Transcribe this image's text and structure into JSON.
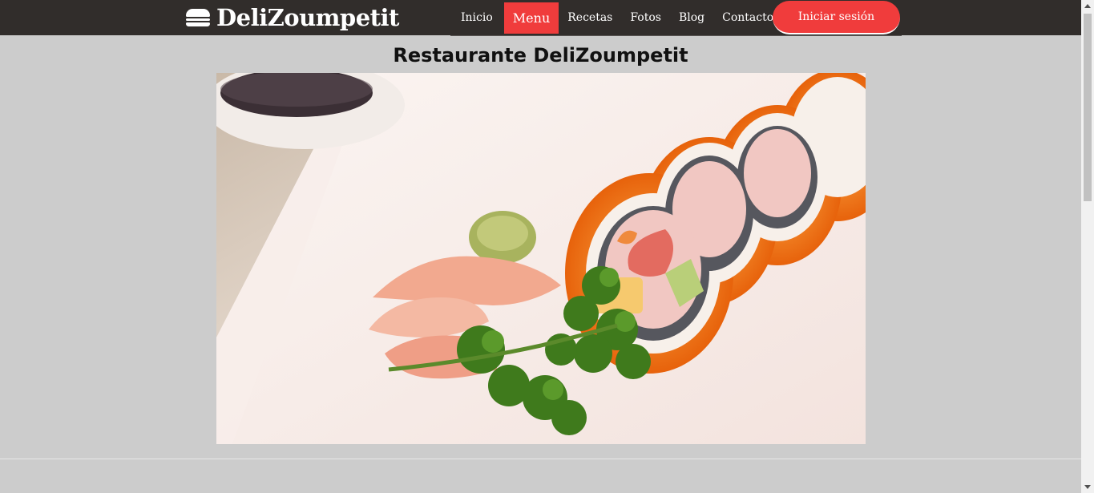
{
  "brand": {
    "name": "DeliZoumpetit",
    "icon": "burger-icon"
  },
  "nav": {
    "items": [
      "Inicio",
      "Menu",
      "Recetas",
      "Fotos",
      "Blog",
      "Contacto"
    ],
    "active": "Menu",
    "login_label": "Iniciar sesión"
  },
  "main": {
    "title": "Restaurante DeliZoumpetit",
    "hero_image": "sushi-roll-photo"
  },
  "colors": {
    "header_bg": "#312d2b",
    "accent": "#f03c3c",
    "page_bg": "#cccccc"
  }
}
